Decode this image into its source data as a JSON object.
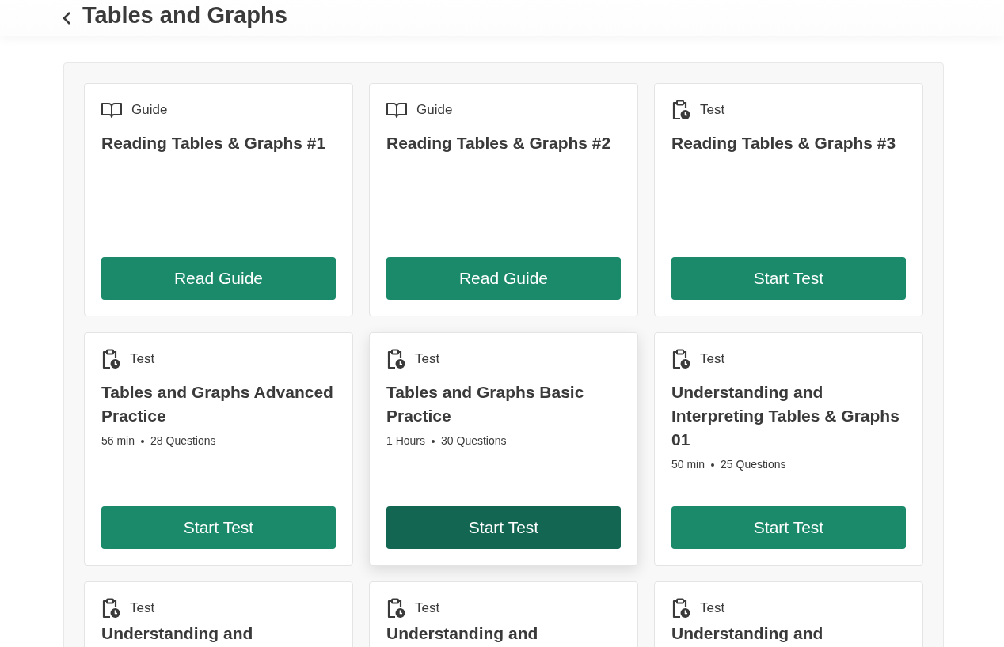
{
  "header": {
    "title": "Tables and Graphs"
  },
  "cards": [
    {
      "kind": "guide",
      "type_label": "Guide",
      "title": "Reading Tables & Graphs #1",
      "button": "Read Guide",
      "hovered": false
    },
    {
      "kind": "guide",
      "type_label": "Guide",
      "title": "Reading Tables & Graphs #2",
      "button": "Read Guide",
      "hovered": false
    },
    {
      "kind": "test",
      "type_label": "Test",
      "title": "Reading Tables & Graphs #3",
      "button": "Start Test",
      "hovered": false
    },
    {
      "kind": "test",
      "type_label": "Test",
      "title": "Tables and Graphs Advanced Practice",
      "meta": [
        "56 min",
        "28 Questions"
      ],
      "button": "Start Test",
      "hovered": false
    },
    {
      "kind": "test",
      "type_label": "Test",
      "title": "Tables and Graphs Basic Practice",
      "meta": [
        "1 Hours",
        "30 Questions"
      ],
      "button": "Start Test",
      "hovered": true
    },
    {
      "kind": "test",
      "type_label": "Test",
      "title": "Understanding and Interpreting Tables & Graphs 01",
      "meta": [
        "50 min",
        "25 Questions"
      ],
      "button": "Start Test",
      "hovered": false
    },
    {
      "kind": "test",
      "type_label": "Test",
      "title": "Understanding and"
    },
    {
      "kind": "test",
      "type_label": "Test",
      "title": "Understanding and"
    },
    {
      "kind": "test",
      "type_label": "Test",
      "title": "Understanding and"
    }
  ]
}
